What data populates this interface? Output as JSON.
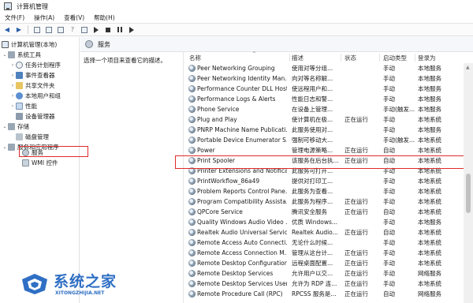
{
  "window": {
    "title": "计算机管理"
  },
  "menu": [
    "文件(F)",
    "操作(A)",
    "查看(V)",
    "帮助(H)"
  ],
  "tree": [
    {
      "label": "计算机管理(本地)",
      "icon": "computer-icon",
      "arrow": ""
    },
    {
      "label": "系统工具",
      "icon": "tools-icon",
      "arrow": "v"
    },
    {
      "label": "任务计划程序",
      "icon": "clock-icon",
      "arrow": ">"
    },
    {
      "label": "事件查看器",
      "icon": "event-log-icon",
      "arrow": ">"
    },
    {
      "label": "共享文件夹",
      "icon": "folder-icon",
      "arrow": ">"
    },
    {
      "label": "本地用户和组",
      "icon": "users-icon",
      "arrow": ">"
    },
    {
      "label": "性能",
      "icon": "performance-icon",
      "arrow": ">"
    },
    {
      "label": "设备管理器",
      "icon": "device-icon",
      "arrow": ""
    },
    {
      "label": "存储",
      "icon": "storage-icon",
      "arrow": "v"
    },
    {
      "label": "磁盘管理",
      "icon": "disk-icon",
      "arrow": ""
    },
    {
      "label": "服务和应用程序",
      "icon": "services-apps-icon",
      "arrow": "v"
    },
    {
      "label": "服务",
      "icon": "gear-icon",
      "arrow": ""
    },
    {
      "label": "WMI 控件",
      "icon": "wmi-icon",
      "arrow": ""
    }
  ],
  "pane": {
    "title": "服务",
    "description": "选择一个项目来查看它的描述。"
  },
  "columns": {
    "name": "名称",
    "desc": "描述",
    "status": "状态",
    "startup": "启动类型",
    "logon": "登录为"
  },
  "services": [
    {
      "name": "Peer Networking Grouping",
      "desc": "使用对等分组...",
      "status": "",
      "startup": "手动",
      "logon": "本地服务"
    },
    {
      "name": "Peer Networking Identity Man...",
      "desc": "向对等名称解...",
      "status": "",
      "startup": "手动",
      "logon": "本地服务"
    },
    {
      "name": "Performance Counter DLL Host",
      "desc": "使远程用户和...",
      "status": "",
      "startup": "手动",
      "logon": "本地服务"
    },
    {
      "name": "Performance Logs & Alerts",
      "desc": "性能日志和警...",
      "status": "",
      "startup": "手动",
      "logon": "本地服务"
    },
    {
      "name": "Phone Service",
      "desc": "在设备上管理...",
      "status": "",
      "startup": "手动(触发...",
      "logon": "本地服务"
    },
    {
      "name": "Plug and Play",
      "desc": "使计算机在极...",
      "status": "正在运行",
      "startup": "手动",
      "logon": "本地系统"
    },
    {
      "name": "PNRP Machine Name Publicati...",
      "desc": "此服务使用对...",
      "status": "",
      "startup": "手动",
      "logon": "本地服务"
    },
    {
      "name": "Portable Device Enumerator S...",
      "desc": "强制可移动大...",
      "status": "",
      "startup": "手动(触发...",
      "logon": "本地系统"
    },
    {
      "name": "Power",
      "desc": "管理电源策略...",
      "status": "正在运行",
      "startup": "自动",
      "logon": "本地系统"
    },
    {
      "name": "Print Spooler",
      "desc": "该服务在后台执...",
      "status": "正在运行",
      "startup": "自动",
      "logon": "本地系统"
    },
    {
      "name": "Printer Extensions and Notifica...",
      "desc": "此服务可打开...",
      "status": "",
      "startup": "手动",
      "logon": "本地系统"
    },
    {
      "name": "PrintWorkflow_86a49",
      "desc": "提供对打印工...",
      "status": "",
      "startup": "手动",
      "logon": "本地系统"
    },
    {
      "name": "Problem Reports Control Pane...",
      "desc": "此服务为查看...",
      "status": "",
      "startup": "手动",
      "logon": "本地系统"
    },
    {
      "name": "Program Compatibility Assista...",
      "desc": "此服务为程序...",
      "status": "正在运行",
      "startup": "手动",
      "logon": "本地系统"
    },
    {
      "name": "QPCore Service",
      "desc": "腾讯安全服务",
      "status": "正在运行",
      "startup": "自动",
      "logon": "本地系统"
    },
    {
      "name": "Quality Windows Audio Video ...",
      "desc": "优质 Windows...",
      "status": "",
      "startup": "手动",
      "logon": "本地服务"
    },
    {
      "name": "Realtek Audio Universal Service",
      "desc": "Realtek Audio...",
      "status": "正在运行",
      "startup": "自动",
      "logon": "本地系统"
    },
    {
      "name": "Remote Access Auto Connecti...",
      "desc": "无论什么时候...",
      "status": "",
      "startup": "手动",
      "logon": "本地系统"
    },
    {
      "name": "Remote Access Connection M...",
      "desc": "管理从这台计...",
      "status": "正在运行",
      "startup": "手动",
      "logon": "本地系统"
    },
    {
      "name": "Remote Desktop Configuration",
      "desc": "远程桌面配置...",
      "status": "正在运行",
      "startup": "手动",
      "logon": "本地系统"
    },
    {
      "name": "Remote Desktop Services",
      "desc": "允许用户以交...",
      "status": "正在运行",
      "startup": "手动",
      "logon": "网络服务"
    },
    {
      "name": "Remote Desktop Services User...",
      "desc": "允许为 RDP 连...",
      "status": "正在运行",
      "startup": "手动",
      "logon": "本地系统"
    },
    {
      "name": "Remote Procedure Call (RPC)",
      "desc": "RPCSS 服务是...",
      "status": "正在运行",
      "startup": "自动",
      "logon": "网络服务"
    }
  ],
  "watermark": {
    "title": "系统之家",
    "url": "XITONGZHIJIA.NET"
  }
}
